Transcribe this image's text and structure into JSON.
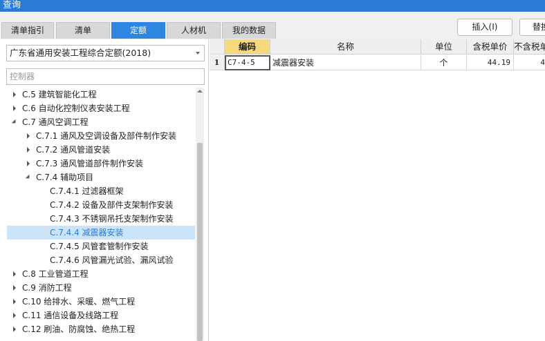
{
  "window": {
    "title": "查询"
  },
  "tabs": [
    {
      "label": "清单指引",
      "active": false
    },
    {
      "label": "清单",
      "active": false
    },
    {
      "label": "定额",
      "active": true
    },
    {
      "label": "人材机",
      "active": false
    },
    {
      "label": "我的数据",
      "active": false
    }
  ],
  "toolbar": {
    "insert_label": "插入(I)",
    "replace_label": "替换"
  },
  "library": {
    "selected": "广东省通用安装工程综合定额(2018)"
  },
  "search": {
    "placeholder": "控制器",
    "value": ""
  },
  "tree": {
    "items": [
      {
        "label": "C.5 建筑智能化工程",
        "expander": "right"
      },
      {
        "label": "C.6 自动化控制仪表安装工程",
        "expander": "right"
      },
      {
        "label": "C.7 通风空调工程",
        "expander": "down"
      },
      {
        "label": "C.7.1 通风及空调设备及部件制作安装",
        "expander": "right"
      },
      {
        "label": "C.7.2 通风管道安装",
        "expander": "right"
      },
      {
        "label": "C.7.3 通风管道部件制作安装",
        "expander": "right"
      },
      {
        "label": "C.7.4 辅助项目",
        "expander": "down"
      },
      {
        "label": "C.7.4.1 过滤器框架",
        "expander": "none"
      },
      {
        "label": "C.7.4.2 设备及部件支架制作安装",
        "expander": "none"
      },
      {
        "label": "C.7.4.3 不锈钢吊托支架制作安装",
        "expander": "none"
      },
      {
        "label": "C.7.4.4 减震器安装",
        "expander": "none",
        "selected": true
      },
      {
        "label": "C.7.4.5 风管套管制作安装",
        "expander": "none"
      },
      {
        "label": "C.7.4.6 风管漏光试验、漏风试验",
        "expander": "none"
      },
      {
        "label": "C.8 工业管道工程",
        "expander": "right"
      },
      {
        "label": "C.9 消防工程",
        "expander": "right"
      },
      {
        "label": "C.10 给排水、采暖、燃气工程",
        "expander": "right"
      },
      {
        "label": "C.11 通信设备及线路工程",
        "expander": "right"
      },
      {
        "label": "C.12 刷油、防腐蚀、绝热工程",
        "expander": "right"
      }
    ]
  },
  "table": {
    "headers": [
      "编码",
      "名称",
      "单位",
      "含税单价",
      "不含税单"
    ],
    "rows": [
      {
        "index": "1",
        "code": "C7-4-5",
        "name": "减震器安装",
        "unit": "个",
        "price_tax": "44.19",
        "price_notax": "4"
      }
    ]
  },
  "colors": {
    "title_bar": "#2a7ad6",
    "active_tab": "#2f86e0",
    "key_header": "#f7d97c",
    "selected_row": "#cce4f7"
  }
}
